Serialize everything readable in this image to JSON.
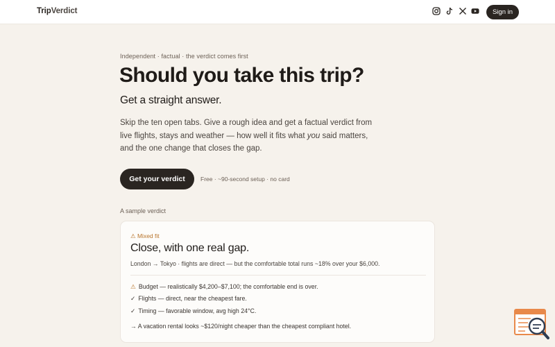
{
  "header": {
    "brand_part1": "Trip",
    "brand_part2": "Verdict",
    "social": [
      "instagram-icon",
      "tiktok-icon",
      "x-icon",
      "youtube-icon"
    ],
    "signin_label": "Sign in"
  },
  "hero": {
    "eyebrow": "Independent · factual · the verdict comes first",
    "headline": "Should you take this trip?",
    "subhead": "Get a straight answer.",
    "body_before": "Skip the ten open tabs. Give a rough idea and get a factual verdict from live flights, stays and weather — how well it fits what ",
    "body_emph": "you",
    "body_after": " said matters, and the one change that closes the gap.",
    "cta_label": "Get your verdict",
    "cta_note": "Free · ~90-second setup · no card"
  },
  "sample": {
    "label": "A sample verdict",
    "badge": "⚠ Mixed fit",
    "title": "Close, with one real gap.",
    "summary": "London → Tokyo · flights are direct — but the comfortable total runs ~18% over your $6,000.",
    "checks": [
      {
        "mark": "⚠",
        "text": "Budget — realistically $4,200–$7,100; the comfortable end is over."
      },
      {
        "mark": "✓",
        "text": "Flights — direct, near the cheapest fare."
      },
      {
        "mark": "✓",
        "text": "Timing — favorable window, avg high 24°C."
      }
    ],
    "tip": "→ A vacation rental looks ~$120/night cheaper than the cheapest compliant hotel."
  },
  "colors": {
    "background": "#f6f2ec",
    "dark": "#2a2521",
    "warning": "#b8742b",
    "widget_orange": "#e8894a",
    "widget_navy": "#2f3d52"
  }
}
